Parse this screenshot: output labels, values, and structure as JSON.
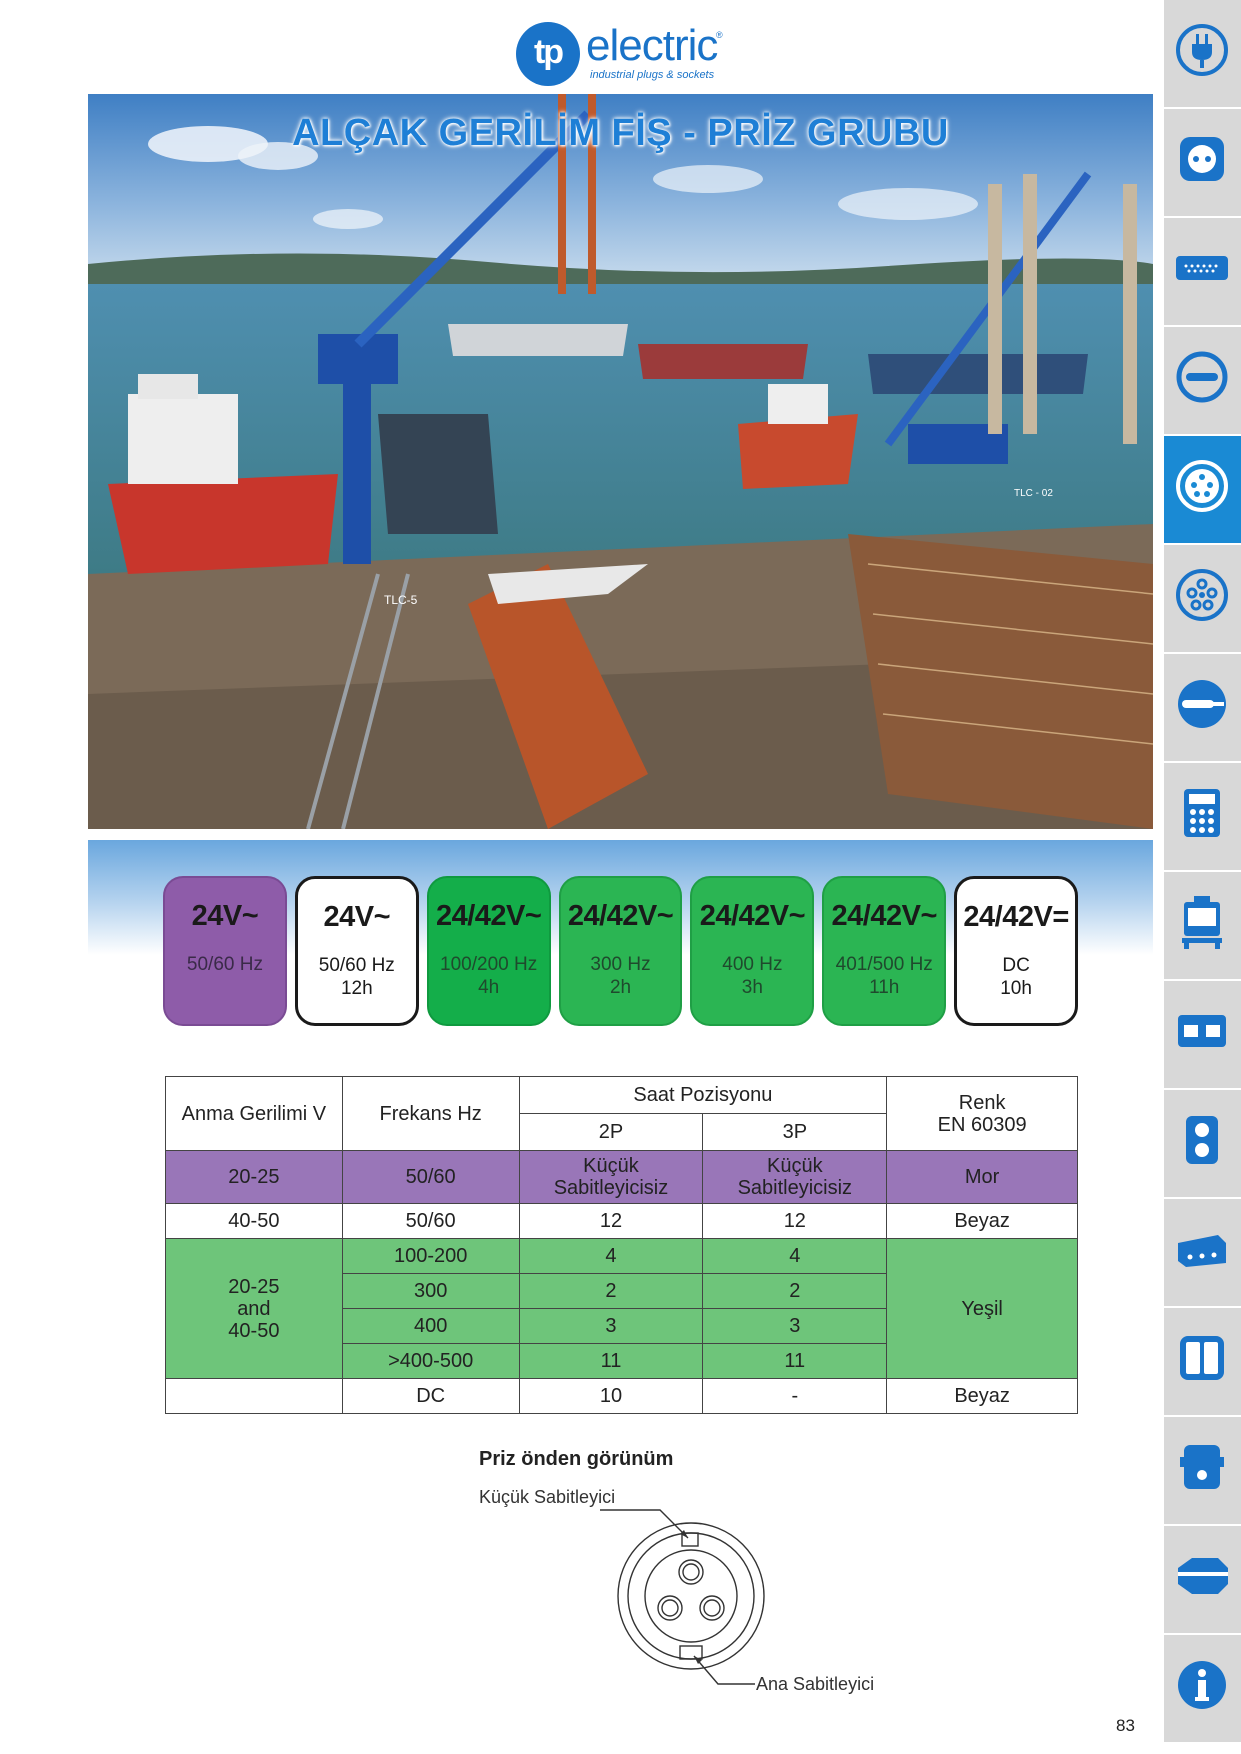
{
  "logo": {
    "mark": "tp",
    "word": "electric",
    "registered": "®",
    "tagline": "industrial plugs & sockets"
  },
  "photo": {
    "title": "ALÇAK GERİLİM FİŞ - PRİZ GRUBU",
    "ship_label_1": "TLC-5",
    "ship_label_2": "TLC - 02"
  },
  "badges": [
    {
      "voltage": "24V~",
      "sub": "50/60 Hz",
      "style": "purple"
    },
    {
      "voltage": "24V~",
      "sub": "50/60 Hz\n12h",
      "style": "white"
    },
    {
      "voltage": "24/42V~",
      "sub": "100/200 Hz\n4h",
      "style": "green"
    },
    {
      "voltage": "24/42V~",
      "sub": "300 Hz\n2h",
      "style": "green2"
    },
    {
      "voltage": "24/42V~",
      "sub": "400 Hz\n3h",
      "style": "green2"
    },
    {
      "voltage": "24/42V~",
      "sub": "401/500 Hz\n11h",
      "style": "green2"
    },
    {
      "voltage": "24/42V=",
      "sub": "DC\n10h",
      "style": "white"
    }
  ],
  "table": {
    "head": {
      "voltage": "Anma Gerilimi V",
      "freq": "Frekans Hz",
      "clock": "Saat Pozisyonu",
      "p2": "2P",
      "p3": "3P",
      "color_line1": "Renk",
      "color_line2": "EN 60309"
    },
    "row_purple": {
      "voltage": "20-25",
      "freq": "50/60",
      "p2_l1": "Küçük",
      "p2_l2": "Sabitleyicisiz",
      "p3_l1": "Küçük",
      "p3_l2": "Sabitleyicisiz",
      "color": "Mor"
    },
    "row_white": {
      "voltage": "40-50",
      "freq": "50/60",
      "p2": "12",
      "p3": "12",
      "color": "Beyaz"
    },
    "green_group": {
      "voltage_l1": "20-25",
      "voltage_l2": "and",
      "voltage_l3": "40-50",
      "color": "Yeşil",
      "rows": [
        {
          "freq": "100-200",
          "p2": "4",
          "p3": "4"
        },
        {
          "freq": "300",
          "p2": "2",
          "p3": "2"
        },
        {
          "freq": "400",
          "p2": "3",
          "p3": "3"
        },
        {
          "freq": ">400-500",
          "p2": "11",
          "p3": "11"
        }
      ]
    },
    "row_dc": {
      "voltage": "",
      "freq": "DC",
      "p2": "10",
      "p3": "-",
      "color": "Beyaz"
    }
  },
  "diagram": {
    "title": "Priz önden görünüm",
    "small_key_label": "Küçük Sabitleyici",
    "main_key_label": "Ana Sabitleyici"
  },
  "sidenav": {
    "items": [
      {
        "icon": "plug-icon",
        "active": false
      },
      {
        "icon": "socket-face-icon",
        "active": false
      },
      {
        "icon": "panel-socket-icon",
        "active": false
      },
      {
        "icon": "minus-circle-icon",
        "active": false
      },
      {
        "icon": "low-voltage-socket-icon",
        "active": true
      },
      {
        "icon": "multi-pin-socket-icon",
        "active": false
      },
      {
        "icon": "plug-side-icon",
        "active": false
      },
      {
        "icon": "distribution-box-icon",
        "active": false
      },
      {
        "icon": "box-on-stand-icon",
        "active": false
      },
      {
        "icon": "wall-box-icon",
        "active": false
      },
      {
        "icon": "double-socket-icon",
        "active": false
      },
      {
        "icon": "cable-box-icon",
        "active": false
      },
      {
        "icon": "split-panel-icon",
        "active": false
      },
      {
        "icon": "enclosure-icon",
        "active": false
      },
      {
        "icon": "hexagon-icon",
        "active": false
      },
      {
        "icon": "info-icon",
        "active": false
      }
    ]
  },
  "page_number": "83",
  "colors": {
    "brand_blue": "#1a73c8",
    "purple": "#9976b8",
    "green": "#6ec57a",
    "nav_active": "#1a8ad4"
  }
}
